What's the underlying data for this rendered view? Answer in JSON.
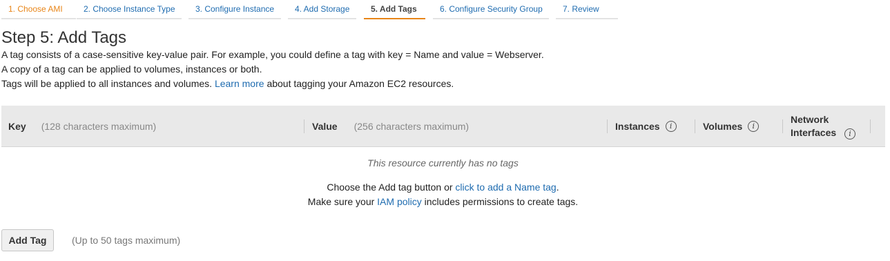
{
  "wizard": {
    "steps": [
      {
        "label": "1. Choose AMI"
      },
      {
        "label": "2. Choose Instance Type"
      },
      {
        "label": "3. Configure Instance"
      },
      {
        "label": "4. Add Storage"
      },
      {
        "label": "5. Add Tags"
      },
      {
        "label": "6. Configure Security Group"
      },
      {
        "label": "7. Review"
      }
    ]
  },
  "page": {
    "title": "Step 5: Add Tags",
    "line1": "A tag consists of a case-sensitive key-value pair. For example, you could define a tag with key = Name and value = Webserver.",
    "line2": "A copy of a tag can be applied to volumes, instances or both.",
    "line3_before": "Tags will be applied to all instances and volumes.",
    "line3_link": "Learn more",
    "line3_after": "about tagging your Amazon EC2 resources."
  },
  "table": {
    "key_label": "Key",
    "key_hint": "(128 characters maximum)",
    "value_label": "Value",
    "value_hint": "(256 characters maximum)",
    "instances_label": "Instances",
    "volumes_label": "Volumes",
    "network_label_1": "Network",
    "network_label_2": "Interfaces",
    "info_glyph": "i"
  },
  "empty_state": {
    "message": "This resource currently has no tags",
    "choose_before": "Choose the Add tag button or",
    "choose_link": "click to add a Name tag",
    "choose_after": ".",
    "iam_before": "Make sure your",
    "iam_link": "IAM policy",
    "iam_after": "includes permissions to create tags."
  },
  "actions": {
    "add_tag_label": "Add Tag",
    "limit_note": "(Up to 50 tags maximum)"
  }
}
